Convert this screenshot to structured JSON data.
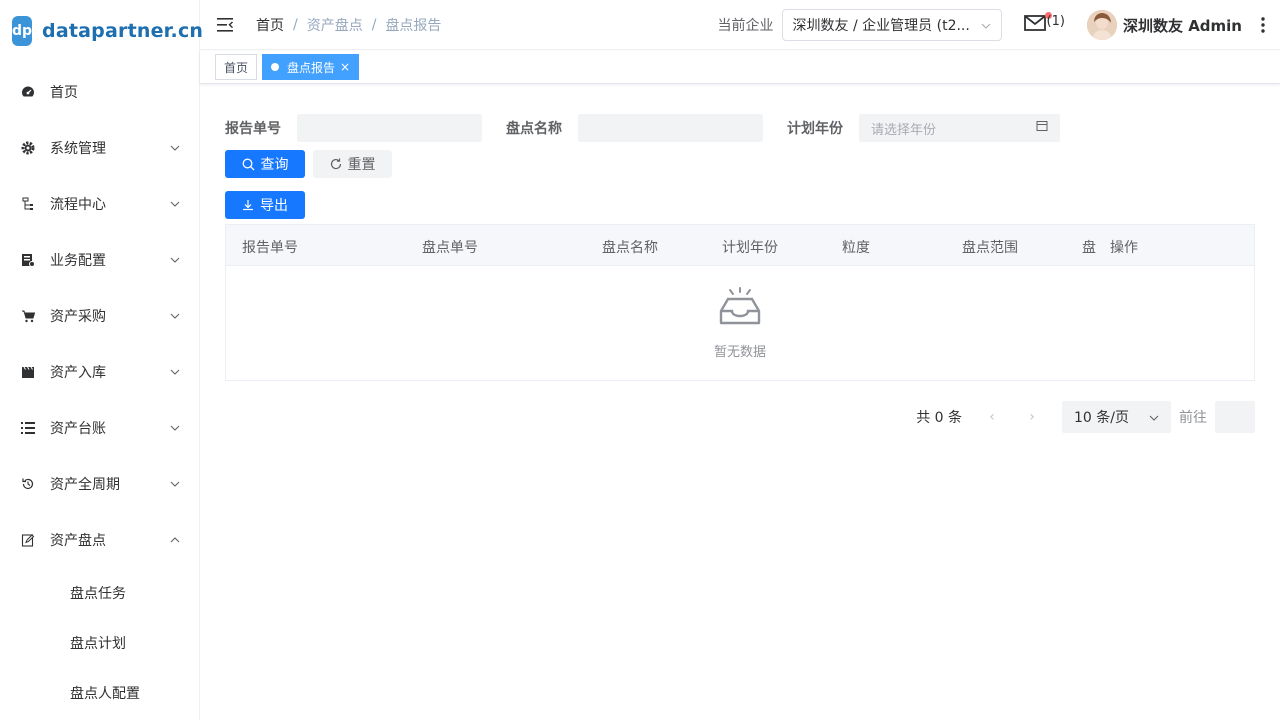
{
  "logo": {
    "badge": "dp",
    "text": "datapartner.cn"
  },
  "sidebar": {
    "items": [
      {
        "label": "首页",
        "icon": "dashboard-icon"
      },
      {
        "label": "系统管理",
        "icon": "gear-icon"
      },
      {
        "label": "流程中心",
        "icon": "flow-icon"
      },
      {
        "label": "业务配置",
        "icon": "business-icon"
      },
      {
        "label": "资产采购",
        "icon": "cart-icon"
      },
      {
        "label": "资产入库",
        "icon": "clapper-icon"
      },
      {
        "label": "资产台账",
        "icon": "list-icon"
      },
      {
        "label": "资产全周期",
        "icon": "cycle-icon"
      },
      {
        "label": "资产盘点",
        "icon": "edit-icon"
      }
    ],
    "sub_items": [
      "盘点任务",
      "盘点计划",
      "盘点人配置"
    ]
  },
  "header": {
    "breadcrumb": [
      "首页",
      "资产盘点",
      "盘点报告"
    ],
    "company_label": "当前企业",
    "company_value": "深圳数友 / 企业管理员 (t2...",
    "mail_count": "(1)",
    "user_name": "深圳数友 Admin"
  },
  "tags": [
    {
      "label": "首页"
    },
    {
      "label": "盘点报告",
      "close": "×"
    }
  ],
  "filters": {
    "report_no_label": "报告单号",
    "check_name_label": "盘点名称",
    "plan_year_label": "计划年份",
    "plan_year_placeholder": "请选择年份"
  },
  "buttons": {
    "search": "查询",
    "reset": "重置",
    "export": "导出"
  },
  "table": {
    "columns": [
      "报告单号",
      "盘点单号",
      "盘点名称",
      "计划年份",
      "粒度",
      "盘点范围",
      "盘",
      "操作"
    ],
    "empty_text": "暂无数据"
  },
  "pagination": {
    "total": "共 0 条",
    "prev": "‹",
    "next": "›",
    "page_size": "10 条/页",
    "goto": "前往"
  },
  "colors": {
    "primary": "#1677ff",
    "tag_active": "#42a0ff",
    "logo": "#3b93d8"
  }
}
